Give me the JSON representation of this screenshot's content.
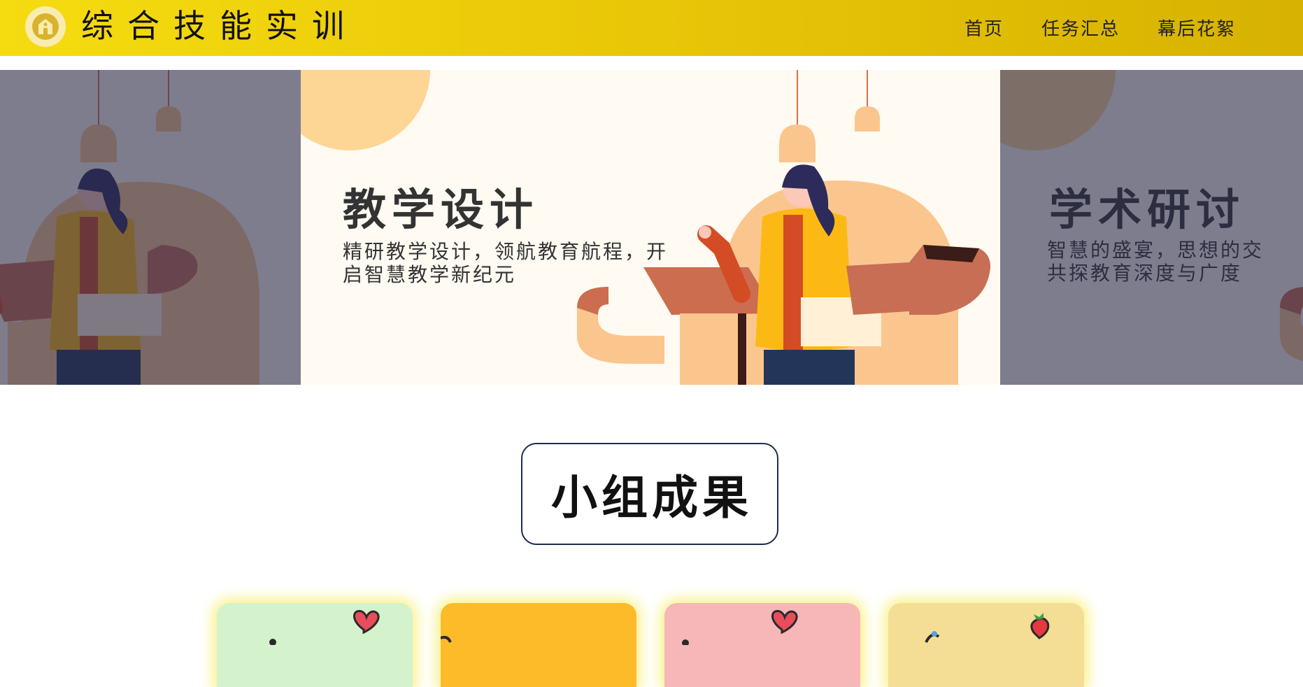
{
  "header": {
    "logo_icon": "school-building-icon",
    "title": "综合技能实训",
    "nav": [
      {
        "label": "首页"
      },
      {
        "label": "任务汇总"
      },
      {
        "label": "幕后花絮"
      }
    ]
  },
  "carousel": {
    "slides": [
      {
        "title": "",
        "description": ""
      },
      {
        "title": "教学设计",
        "description": "精研教学设计，领航教育航程，开启智慧教学新纪元"
      },
      {
        "title": "学术研讨",
        "description": "智慧的盛宴，思想的交\n共探教育深度与广度"
      }
    ],
    "illustration": "teacher-at-podium-illustration"
  },
  "section": {
    "title": "小组成果"
  },
  "cards": [
    {
      "background": "#d4f2cc",
      "icon": "heart-icon"
    },
    {
      "background": "#fdbb2a",
      "icon": "sticker-icon"
    },
    {
      "background": "#f7b6b8",
      "icon": "heart-icon"
    },
    {
      "background": "#f4de96",
      "icon": "strawberry-icon"
    }
  ],
  "colors": {
    "header_gradient_start": "#f5dc10",
    "header_gradient_end": "#d7b201",
    "section_border": "#1c2c4c",
    "card_glow": "#f8ee62"
  }
}
